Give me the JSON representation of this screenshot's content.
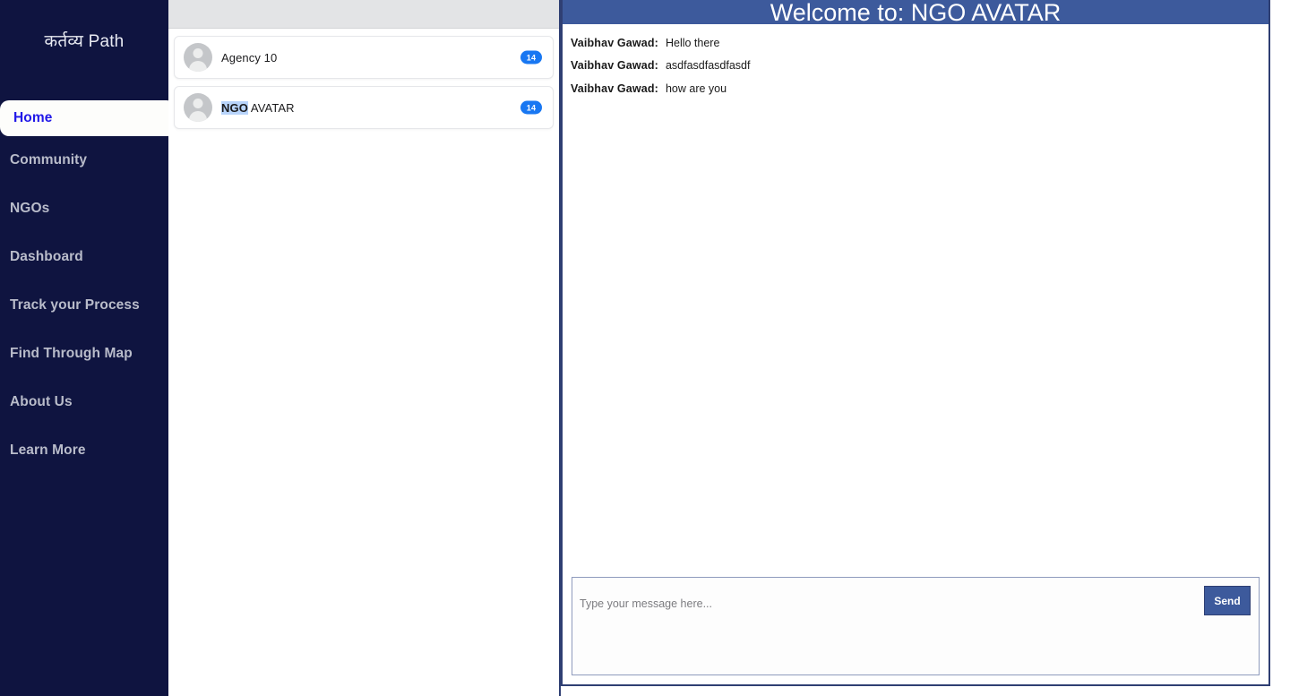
{
  "sidebar": {
    "brand": "कर्तव्य Path",
    "items": [
      {
        "label": "Home",
        "active": true
      },
      {
        "label": "Community",
        "active": false
      },
      {
        "label": "NGOs",
        "active": false
      },
      {
        "label": "Dashboard",
        "active": false
      },
      {
        "label": "Track your Process",
        "active": false
      },
      {
        "label": "Find Through Map",
        "active": false
      },
      {
        "label": "About Us",
        "active": false
      },
      {
        "label": "Learn More",
        "active": false
      }
    ],
    "colors": {
      "background": "#0f1440",
      "text": "#b9bcca",
      "active_text": "#2118e8",
      "active_bg": "#fdfdfb"
    }
  },
  "contacts": [
    {
      "name": "Agency 10",
      "name_selected": "",
      "name_rest": "Agency 10",
      "badge": "14"
    },
    {
      "name": "NGO AVATAR",
      "name_selected": "NGO",
      "name_rest": " AVATAR",
      "badge": "14"
    }
  ],
  "chat": {
    "header_title": "Welcome to: NGO AVATAR",
    "messages": [
      {
        "sender": "Vaibhav Gawad:",
        "text": "Hello there"
      },
      {
        "sender": "Vaibhav Gawad:",
        "text": "asdfasdfasdfasdf"
      },
      {
        "sender": "Vaibhav Gawad:",
        "text": "how are you"
      }
    ],
    "input_placeholder": "Type your message here...",
    "input_value": "",
    "send_label": "Send",
    "colors": {
      "header_bg": "#3d5a9c",
      "border": "#2f3f73",
      "badge": "#1877f2"
    }
  }
}
